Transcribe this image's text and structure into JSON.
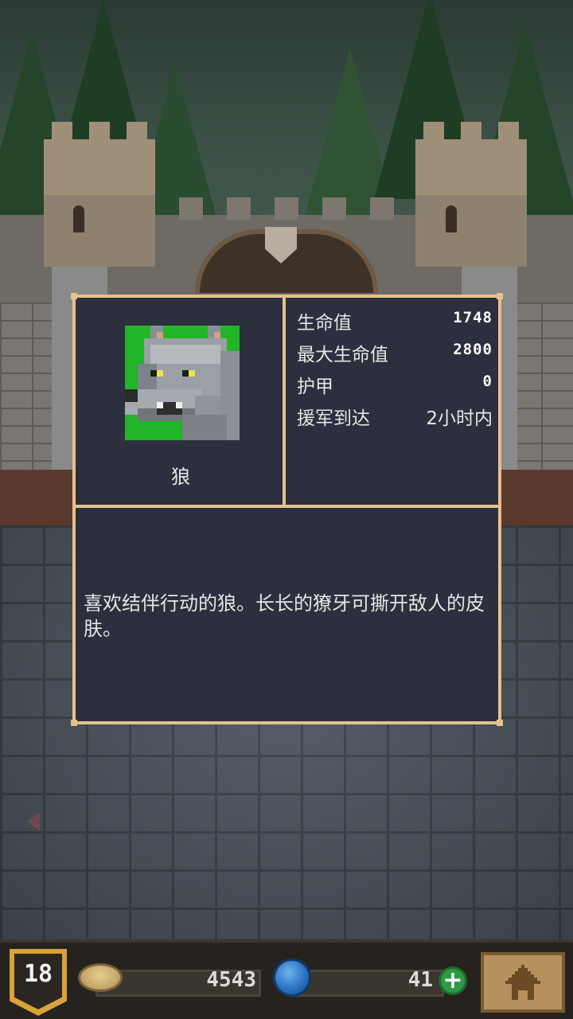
{
  "unit": {
    "name": "狼",
    "portrait_icon": "wolf-portrait-icon",
    "portrait_bg_color": "#22b528",
    "description": "喜欢结伴行动的狼。长长的獠牙可撕开敌人的皮肤。"
  },
  "stats": [
    {
      "label": "生命值",
      "value": "1748"
    },
    {
      "label": "最大生命值",
      "value": "2800"
    },
    {
      "label": "护甲",
      "value": "0"
    },
    {
      "label": "援军到达",
      "value": "2小时内"
    }
  ],
  "bottom_bar": {
    "level": "18",
    "gold": "4543",
    "gems": "41",
    "icons": {
      "level": "shield-badge-icon",
      "gold": "coin-icon",
      "gems": "blue-gem-icon",
      "add": "plus-icon",
      "home": "home-icon"
    }
  },
  "colors": {
    "panel_border": "#e7c08a",
    "panel_bg": "#2c2f3d",
    "add_button": "#2f9a45",
    "level_badge": "#d9a23a"
  }
}
